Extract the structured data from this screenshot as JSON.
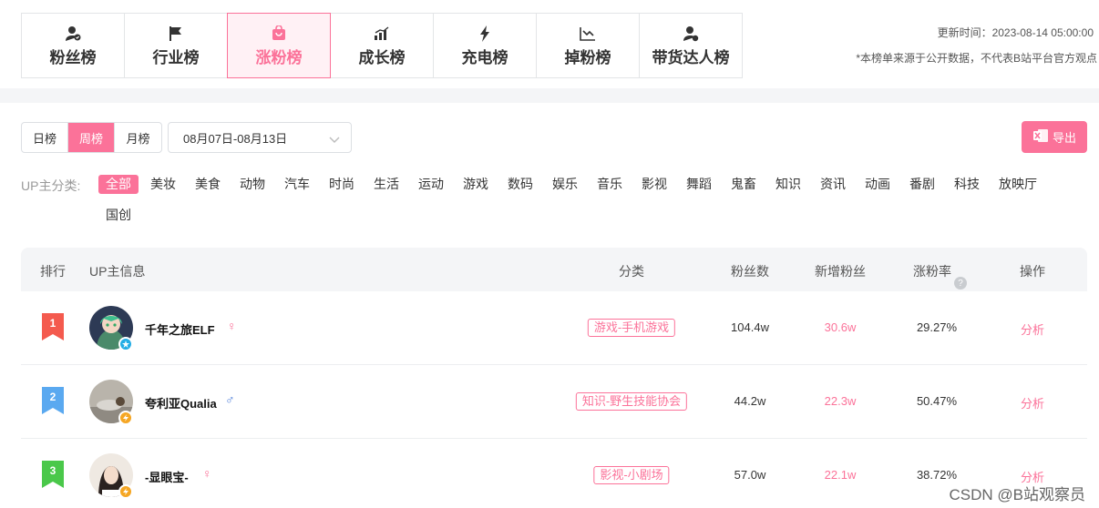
{
  "top_tabs": [
    {
      "label": "粉丝榜",
      "icon": "user-icon",
      "active": false
    },
    {
      "label": "行业榜",
      "icon": "flag-icon",
      "active": false
    },
    {
      "label": "涨粉榜",
      "icon": "bag-icon",
      "active": true
    },
    {
      "label": "成长榜",
      "icon": "growth-chart-icon",
      "active": false
    },
    {
      "label": "充电榜",
      "icon": "lightning-icon",
      "active": false
    },
    {
      "label": "掉粉榜",
      "icon": "decline-chart-icon",
      "active": false
    },
    {
      "label": "带货达人榜",
      "icon": "user-star-icon",
      "active": false
    }
  ],
  "update_time": "更新时间：2023-08-14 05:00:00",
  "update_note": "*本榜单来源于公开数据，不代表B站平台官方观点",
  "period_tabs": [
    {
      "label": "日榜",
      "active": false
    },
    {
      "label": "周榜",
      "active": true
    },
    {
      "label": "月榜",
      "active": false
    }
  ],
  "date_range": "08月07日-08月13日",
  "export_label": "导出",
  "category_label": "UP主分类:",
  "categories": [
    "全部",
    "美妆",
    "美食",
    "动物",
    "汽车",
    "时尚",
    "生活",
    "运动",
    "游戏",
    "数码",
    "娱乐",
    "音乐",
    "影视",
    "舞蹈",
    "鬼畜",
    "知识",
    "资讯",
    "动画",
    "番剧",
    "科技",
    "放映厅",
    "国创"
  ],
  "table_headers": {
    "rank": "排行",
    "up_info": "UP主信息",
    "category": "分类",
    "fans": "粉丝数",
    "new_fans": "新增粉丝",
    "growth_rate": "涨粉率",
    "action": "操作"
  },
  "rows": [
    {
      "rank": "1",
      "name": "千年之旅ELF",
      "gender": "♀",
      "category": "游戏-手机游戏",
      "fans": "104.4w",
      "new_fans": "30.6w",
      "growth_rate": "29.27%",
      "action": "分析"
    },
    {
      "rank": "2",
      "name": "夸利亚Qualia",
      "gender": "♂",
      "category": "知识-野生技能协会",
      "fans": "44.2w",
      "new_fans": "22.3w",
      "growth_rate": "50.47%",
      "action": "分析"
    },
    {
      "rank": "3",
      "name": "-显眼宝-",
      "gender": "♀",
      "category": "影视-小剧场",
      "fans": "57.0w",
      "new_fans": "22.1w",
      "growth_rate": "38.72%",
      "action": "分析"
    }
  ],
  "watermark": "CSDN @B站观察员",
  "colors": {
    "accent": "#fb7299",
    "rank1": "#f45a4e",
    "rank2": "#5aa9f0",
    "rank3": "#4ac84a"
  }
}
